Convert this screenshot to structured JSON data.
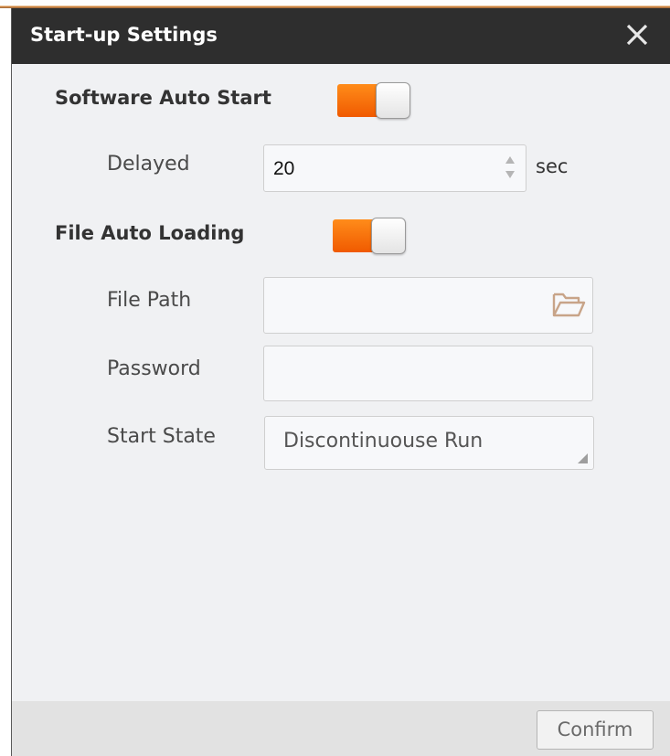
{
  "dialog": {
    "title": "Start-up Settings",
    "close_icon": "close-icon",
    "confirm_label": "Confirm"
  },
  "software_auto_start": {
    "label": "Software Auto Start",
    "enabled": true,
    "delayed_label": "Delayed",
    "delayed_value": "20",
    "unit": "sec"
  },
  "file_auto_loading": {
    "label": "File Auto Loading",
    "enabled": true,
    "file_path_label": "File Path",
    "file_path_value": "",
    "folder_icon": "folder-open-icon",
    "password_label": "Password",
    "password_value": "",
    "start_state_label": "Start State",
    "start_state_value": "Discontinuouse Run"
  },
  "colors": {
    "accent": "#f26a0a",
    "titlebar": "#2e2e2e",
    "background": "#f0f1f3",
    "folder_icon": "#c8a488"
  }
}
